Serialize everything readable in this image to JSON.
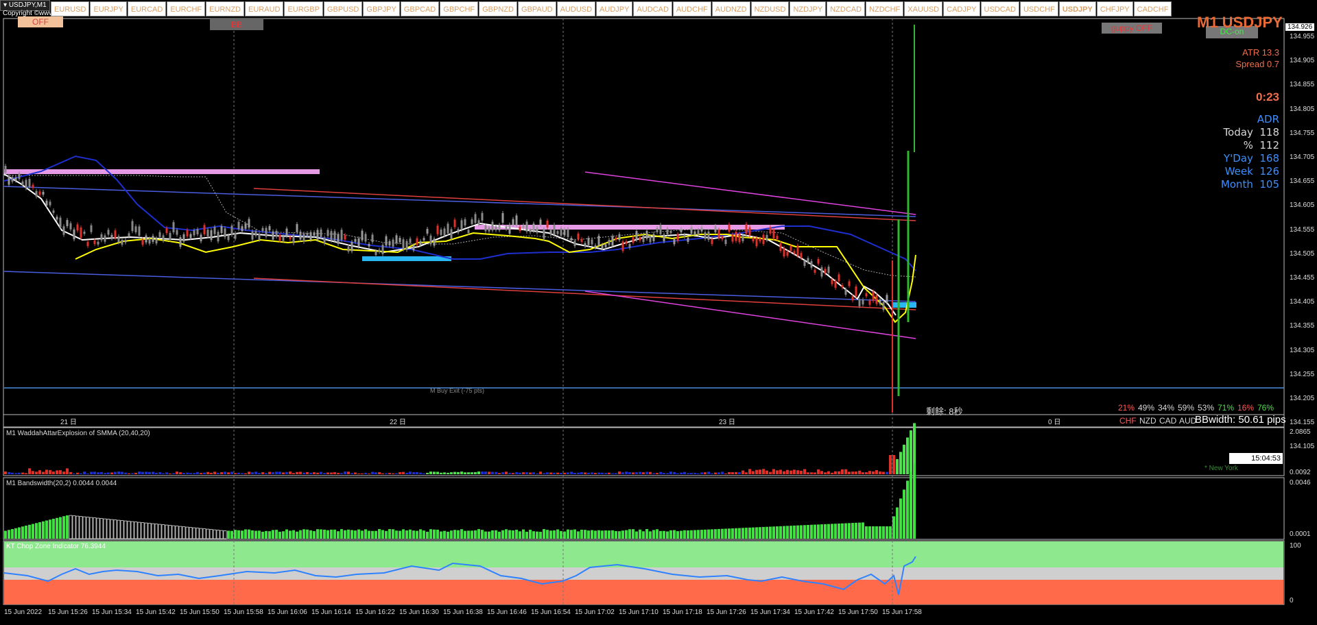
{
  "window": {
    "title": "USDJPY,M1",
    "copyright": "Copyright ©www..."
  },
  "symbols": [
    "EURUSD",
    "EURJPY",
    "EURCAD",
    "EURCHF",
    "EURNZD",
    "EURAUD",
    "EURGBP",
    "GBPUSD",
    "GBPJPY",
    "GBPCAD",
    "GBPCHF",
    "GBPNZD",
    "GBPAUD",
    "AUDUSD",
    "AUDJPY",
    "AUDCAD",
    "AUDCHF",
    "AUDNZD",
    "NZDUSD",
    "NZDJPY",
    "NZDCAD",
    "NZDCHF",
    "XAUUSD",
    "CADJPY",
    "USDCAD",
    "USDCHF",
    "USDJPY",
    "CHFJPY",
    "CADCHF"
  ],
  "active_symbol": "USDJPY",
  "buttons": {
    "off": "OFF",
    "bb": "BB",
    "guppy": "guppy OFF",
    "dc": "DC-on"
  },
  "pair_title": "M1 USDJPY",
  "info": {
    "atr": "ATR 13.3",
    "spread": "Spread 0.7",
    "timer": "0:23"
  },
  "adr": {
    "header": "ADR",
    "rows": [
      {
        "label": "Today",
        "value": "118",
        "color": "#d8d8d8"
      },
      {
        "label": "%",
        "value": "112",
        "color": "#d8d8d8"
      },
      {
        "label": "Y'Day",
        "value": "168",
        "color": "#3d8fff"
      },
      {
        "label": "Week",
        "value": "126",
        "color": "#3d8fff"
      },
      {
        "label": "Month",
        "value": "105",
        "color": "#3d8fff"
      }
    ]
  },
  "price_axis": {
    "current": "134.926",
    "ticks": [
      "134.955",
      "134.905",
      "134.855",
      "134.805",
      "134.755",
      "134.705",
      "134.655",
      "134.605",
      "134.555",
      "134.505",
      "134.455",
      "134.405",
      "134.355",
      "134.305",
      "134.255",
      "134.205",
      "134.155",
      "134.105"
    ]
  },
  "main_chart": {
    "buy_exit_label": "M Buy Exit (-75 pts)",
    "countdown_label": "剩餘: 8秒",
    "day_labels": [
      "21 日",
      "22 日",
      "23 日",
      "0 日"
    ],
    "bbwidth": "BBwidth: 50.61 pips"
  },
  "currency_strength": {
    "values": [
      {
        "pct": "21%",
        "color": "#ff5a5a"
      },
      {
        "pct": "49%",
        "color": "#d8d8d8"
      },
      {
        "pct": "34%",
        "color": "#d8d8d8"
      },
      {
        "pct": "59%",
        "color": "#d8d8d8"
      },
      {
        "pct": "53%",
        "color": "#d8d8d8"
      },
      {
        "pct": "71%",
        "color": "#4ee04e"
      },
      {
        "pct": "16%",
        "color": "#ff5a5a"
      },
      {
        "pct": "76%",
        "color": "#4ee04e"
      }
    ],
    "currencies": [
      {
        "name": "CHF",
        "color": "#ff5a5a"
      },
      {
        "name": "NZD",
        "color": "#d8d8d8"
      },
      {
        "name": "CAD",
        "color": "#d8d8d8"
      },
      {
        "name": "AUD",
        "color": "#d8d8d8"
      }
    ]
  },
  "waddah": {
    "label": "M1 WaddahAttarExplosion of SMMA (20,40,20)",
    "axis_top": "2.0865",
    "axis_bottom": "0.0092",
    "session_time": "15:04:53",
    "session_label": "* New York"
  },
  "bandswidth": {
    "label": "M1 Bandswidth(20,2) 0.0044 0.0044",
    "axis_top": "0.0046",
    "axis_bottom": "0.0001"
  },
  "chopzone": {
    "label": "KT Chop Zone Indicator 76.3944",
    "axis_top": "100",
    "axis_bottom": "0"
  },
  "time_axis": [
    "15 Jun 2022",
    "15 Jun 15:26",
    "15 Jun 15:34",
    "15 Jun 15:42",
    "15 Jun 15:50",
    "15 Jun 15:58",
    "15 Jun 16:06",
    "15 Jun 16:14",
    "15 Jun 16:22",
    "15 Jun 16:30",
    "15 Jun 16:38",
    "15 Jun 16:46",
    "15 Jun 16:54",
    "15 Jun 17:02",
    "15 Jun 17:10",
    "15 Jun 17:18",
    "15 Jun 17:26",
    "15 Jun 17:34",
    "15 Jun 17:42",
    "15 Jun 17:50",
    "15 Jun 17:58"
  ]
}
